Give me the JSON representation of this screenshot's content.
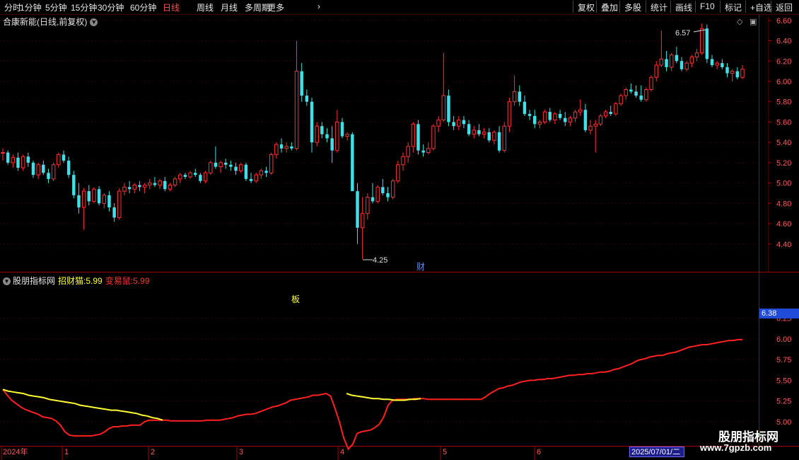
{
  "toolbar": {
    "periods": [
      "分时",
      "1分钟",
      "5分钟",
      "15分钟",
      "30分钟",
      "60分钟",
      "日线",
      "周线",
      "月线",
      "多周期",
      "更多"
    ],
    "active_period": "日线",
    "buttons": [
      "复权",
      "叠加",
      "多股",
      "统计",
      "画线",
      "F10",
      "标记",
      "+自选",
      "返回"
    ]
  },
  "main_title": "合康新能(日线,前复权)",
  "indicator": {
    "name": "股朋指标网",
    "series1_label": "招财猫:",
    "series1_value": "5.99",
    "series2_label": "变易鼠:",
    "series2_value": "5.99",
    "marker_text": "板",
    "current_price_tag": "6.38"
  },
  "annotations": {
    "high_label": "6.57",
    "low_label": "4.25",
    "cai_marker": "财"
  },
  "x_axis": {
    "year_label": "2024年",
    "month_labels": [
      "1",
      "2",
      "3",
      "4",
      "5",
      "6"
    ],
    "cursor_date": "2025/07/01/二"
  },
  "watermark": {
    "name": "股朋指标网",
    "url": "www.7gpzb.com"
  },
  "colors": {
    "up": "#ff3232",
    "down": "#3fe0e8",
    "yellow": "#ffff33",
    "red_line": "#ff2020",
    "grid": "#5a0000"
  },
  "chart_data": [
    {
      "type": "candlestick",
      "title": "合康新能(日线,前复权)",
      "ylim": [
        4.2,
        6.7
      ],
      "yticks": [
        4.4,
        4.6,
        4.8,
        5.0,
        5.2,
        5.4,
        5.6,
        5.8,
        6.0,
        6.2,
        6.4,
        6.6
      ],
      "ytick_labels": [
        "4.40",
        "4.60",
        "4.80",
        "5.00",
        "5.20",
        "5.40",
        "5.60",
        "5.80",
        "6.00",
        "6.20",
        "6.40",
        "6.60"
      ],
      "grid": true,
      "ohlc": [
        [
          5.3,
          5.34,
          5.22,
          5.3
        ],
        [
          5.3,
          5.32,
          5.18,
          5.2
        ],
        [
          5.2,
          5.28,
          5.15,
          5.25
        ],
        [
          5.25,
          5.3,
          5.12,
          5.15
        ],
        [
          5.15,
          5.28,
          5.12,
          5.26
        ],
        [
          5.26,
          5.3,
          5.16,
          5.2
        ],
        [
          5.2,
          5.22,
          5.05,
          5.08
        ],
        [
          5.08,
          5.2,
          5.04,
          5.18
        ],
        [
          5.18,
          5.22,
          5.08,
          5.1
        ],
        [
          5.1,
          5.14,
          5.0,
          5.04
        ],
        [
          5.04,
          5.2,
          5.02,
          5.18
        ],
        [
          5.18,
          5.3,
          5.15,
          5.28
        ],
        [
          5.28,
          5.32,
          5.2,
          5.22
        ],
        [
          5.22,
          5.26,
          5.05,
          5.08
        ],
        [
          5.08,
          5.12,
          4.85,
          4.88
        ],
        [
          4.88,
          5.0,
          4.7,
          4.76
        ],
        [
          4.76,
          4.95,
          4.54,
          4.92
        ],
        [
          4.92,
          4.98,
          4.78,
          4.82
        ],
        [
          4.82,
          4.96,
          4.8,
          4.94
        ],
        [
          4.94,
          4.97,
          4.78,
          4.8
        ],
        [
          4.8,
          4.9,
          4.75,
          4.88
        ],
        [
          4.88,
          4.92,
          4.72,
          4.76
        ],
        [
          4.76,
          4.8,
          4.62,
          4.66
        ],
        [
          4.66,
          4.95,
          4.64,
          4.92
        ],
        [
          4.92,
          5.0,
          4.88,
          4.96
        ],
        [
          4.96,
          5.02,
          4.9,
          4.94
        ],
        [
          4.94,
          5.0,
          4.9,
          4.98
        ],
        [
          4.98,
          5.02,
          4.92,
          4.96
        ],
        [
          4.96,
          5.0,
          4.9,
          4.98
        ],
        [
          4.98,
          5.04,
          4.94,
          5.0
        ],
        [
          5.0,
          5.06,
          4.96,
          4.98
        ],
        [
          4.98,
          5.04,
          4.94,
          5.02
        ],
        [
          5.02,
          5.06,
          4.92,
          4.94
        ],
        [
          4.94,
          5.0,
          4.92,
          4.98
        ],
        [
          4.98,
          5.06,
          4.96,
          5.04
        ],
        [
          5.04,
          5.1,
          5.0,
          5.08
        ],
        [
          5.08,
          5.1,
          5.04,
          5.06
        ],
        [
          5.06,
          5.12,
          5.04,
          5.1
        ],
        [
          5.1,
          5.14,
          5.06,
          5.08
        ],
        [
          5.08,
          5.1,
          5.0,
          5.02
        ],
        [
          5.02,
          5.12,
          5.0,
          5.1
        ],
        [
          5.1,
          5.22,
          5.08,
          5.2
        ],
        [
          5.2,
          5.36,
          5.14,
          5.16
        ],
        [
          5.16,
          5.22,
          5.1,
          5.2
        ],
        [
          5.2,
          5.24,
          5.14,
          5.18
        ],
        [
          5.18,
          5.22,
          5.12,
          5.16
        ],
        [
          5.16,
          5.2,
          5.08,
          5.12
        ],
        [
          5.12,
          5.2,
          5.1,
          5.18
        ],
        [
          5.18,
          5.2,
          5.02,
          5.04
        ],
        [
          5.04,
          5.1,
          5.0,
          5.02
        ],
        [
          5.02,
          5.1,
          5.0,
          5.08
        ],
        [
          5.08,
          5.14,
          5.04,
          5.12
        ],
        [
          5.12,
          5.16,
          5.06,
          5.1
        ],
        [
          5.1,
          5.3,
          5.08,
          5.28
        ],
        [
          5.28,
          5.4,
          5.24,
          5.38
        ],
        [
          5.38,
          5.44,
          5.3,
          5.34
        ],
        [
          5.34,
          5.4,
          5.3,
          5.36
        ],
        [
          5.36,
          5.4,
          5.32,
          5.34
        ],
        [
          5.34,
          6.4,
          5.32,
          6.1
        ],
        [
          6.1,
          6.18,
          5.8,
          5.86
        ],
        [
          5.86,
          5.92,
          5.76,
          5.8
        ],
        [
          5.8,
          5.84,
          5.3,
          5.4
        ],
        [
          5.4,
          5.6,
          5.36,
          5.56
        ],
        [
          5.56,
          5.6,
          5.44,
          5.48
        ],
        [
          5.48,
          5.54,
          5.4,
          5.44
        ],
        [
          5.44,
          5.56,
          5.2,
          5.32
        ],
        [
          5.32,
          5.72,
          5.3,
          5.6
        ],
        [
          5.6,
          5.64,
          5.44,
          5.46
        ],
        [
          5.46,
          5.5,
          5.42,
          5.48
        ],
        [
          5.48,
          5.5,
          5.1,
          4.92
        ],
        [
          4.92,
          5.0,
          4.4,
          4.56
        ],
        [
          4.56,
          4.86,
          4.25,
          4.7
        ],
        [
          4.7,
          4.9,
          4.64,
          4.86
        ],
        [
          4.86,
          5.0,
          4.8,
          4.82
        ],
        [
          4.82,
          4.98,
          4.8,
          4.96
        ],
        [
          4.96,
          5.04,
          4.88,
          4.9
        ],
        [
          4.9,
          4.96,
          4.82,
          4.86
        ],
        [
          4.86,
          5.04,
          4.84,
          5.02
        ],
        [
          5.02,
          5.22,
          5.0,
          5.18
        ],
        [
          5.18,
          5.3,
          5.12,
          5.26
        ],
        [
          5.26,
          5.4,
          5.2,
          5.36
        ],
        [
          5.36,
          5.6,
          5.3,
          5.58
        ],
        [
          5.58,
          5.62,
          5.28,
          5.32
        ],
        [
          5.32,
          5.38,
          5.26,
          5.3
        ],
        [
          5.3,
          5.4,
          5.28,
          5.34
        ],
        [
          5.34,
          5.58,
          5.32,
          5.56
        ],
        [
          5.56,
          5.66,
          5.5,
          5.62
        ],
        [
          5.62,
          6.28,
          5.6,
          5.86
        ],
        [
          5.86,
          5.92,
          5.56,
          5.6
        ],
        [
          5.6,
          5.66,
          5.52,
          5.56
        ],
        [
          5.56,
          5.66,
          5.52,
          5.62
        ],
        [
          5.62,
          5.66,
          5.54,
          5.58
        ],
        [
          5.58,
          5.62,
          5.46,
          5.48
        ],
        [
          5.48,
          5.56,
          5.44,
          5.52
        ],
        [
          5.52,
          5.58,
          5.46,
          5.48
        ],
        [
          5.48,
          5.54,
          5.44,
          5.5
        ],
        [
          5.5,
          5.54,
          5.4,
          5.42
        ],
        [
          5.42,
          5.52,
          5.38,
          5.5
        ],
        [
          5.5,
          5.56,
          5.3,
          5.32
        ],
        [
          5.32,
          5.6,
          5.3,
          5.56
        ],
        [
          5.56,
          5.84,
          5.5,
          5.8
        ],
        [
          5.8,
          6.06,
          5.76,
          5.9
        ],
        [
          5.9,
          5.96,
          5.76,
          5.8
        ],
        [
          5.8,
          5.86,
          5.66,
          5.68
        ],
        [
          5.68,
          5.72,
          5.62,
          5.66
        ],
        [
          5.66,
          5.72,
          5.54,
          5.58
        ],
        [
          5.58,
          5.62,
          5.54,
          5.6
        ],
        [
          5.6,
          5.72,
          5.58,
          5.7
        ],
        [
          5.7,
          5.74,
          5.6,
          5.62
        ],
        [
          5.62,
          5.7,
          5.58,
          5.68
        ],
        [
          5.68,
          5.72,
          5.62,
          5.64
        ],
        [
          5.64,
          5.7,
          5.56,
          5.6
        ],
        [
          5.6,
          5.66,
          5.56,
          5.64
        ],
        [
          5.64,
          5.72,
          5.6,
          5.7
        ],
        [
          5.7,
          5.82,
          5.66,
          5.72
        ],
        [
          5.72,
          5.78,
          5.5,
          5.52
        ],
        [
          5.52,
          5.62,
          5.48,
          5.56
        ],
        [
          5.56,
          5.62,
          5.3,
          5.58
        ],
        [
          5.58,
          5.68,
          5.56,
          5.66
        ],
        [
          5.66,
          5.72,
          5.64,
          5.7
        ],
        [
          5.7,
          5.76,
          5.66,
          5.68
        ],
        [
          5.68,
          5.8,
          5.66,
          5.78
        ],
        [
          5.78,
          5.88,
          5.76,
          5.86
        ],
        [
          5.86,
          5.94,
          5.82,
          5.92
        ],
        [
          5.92,
          5.98,
          5.88,
          5.9
        ],
        [
          5.9,
          5.96,
          5.84,
          5.86
        ],
        [
          5.86,
          5.96,
          5.8,
          5.82
        ],
        [
          5.82,
          5.94,
          5.8,
          5.92
        ],
        [
          5.92,
          6.06,
          5.9,
          6.04
        ],
        [
          6.04,
          6.2,
          6.0,
          6.16
        ],
        [
          6.16,
          6.5,
          6.14,
          6.22
        ],
        [
          6.22,
          6.3,
          6.1,
          6.14
        ],
        [
          6.14,
          6.28,
          6.1,
          6.26
        ],
        [
          6.26,
          6.34,
          6.18,
          6.2
        ],
        [
          6.2,
          6.24,
          6.1,
          6.12
        ],
        [
          6.12,
          6.2,
          6.1,
          6.18
        ],
        [
          6.18,
          6.26,
          6.14,
          6.24
        ],
        [
          6.24,
          6.32,
          6.2,
          6.28
        ],
        [
          6.28,
          6.57,
          6.26,
          6.52
        ],
        [
          6.52,
          6.56,
          6.18,
          6.22
        ],
        [
          6.22,
          6.26,
          6.14,
          6.16
        ],
        [
          6.16,
          6.2,
          6.12,
          6.18
        ],
        [
          6.18,
          6.22,
          6.12,
          6.14
        ],
        [
          6.14,
          6.18,
          6.04,
          6.08
        ],
        [
          6.08,
          6.12,
          6.0,
          6.1
        ],
        [
          6.1,
          6.14,
          6.02,
          6.04
        ],
        [
          6.04,
          6.16,
          6.02,
          6.12
        ]
      ]
    },
    {
      "type": "line",
      "ylim": [
        5.0,
        6.45
      ],
      "yticks": [
        5.0,
        5.25,
        5.5,
        5.75,
        6.0,
        6.25
      ],
      "ytick_labels": [
        "5.00",
        "5.25",
        "5.50",
        "5.75",
        "6.00",
        "6.25"
      ],
      "grid": true,
      "series": [
        {
          "name": "招财猫",
          "color": "#ffff33",
          "values": [
            5.39,
            5.37,
            5.36,
            5.35,
            5.34,
            5.32,
            5.31,
            5.3,
            5.29,
            5.27,
            5.26,
            5.25,
            5.24,
            5.23,
            5.22,
            5.2,
            5.19,
            5.18,
            5.17,
            5.16,
            5.15,
            5.14,
            5.14,
            5.13,
            5.12,
            5.11,
            5.1,
            5.08,
            5.07,
            5.05,
            5.04,
            5.02
          ]
        },
        {
          "name": "变易鼠",
          "color": "#ff2020",
          "values": [
            5.39,
            5.32,
            5.26,
            5.22,
            5.18,
            5.15,
            5.13,
            5.11,
            5.09,
            5.06,
            5.05,
            5.04,
            5.01,
            4.96,
            4.88,
            4.84,
            4.83,
            4.83,
            4.83,
            4.83,
            4.83,
            4.84,
            4.85,
            4.88,
            4.92,
            4.94,
            4.94,
            4.95,
            4.95,
            4.96,
            4.96,
            4.96,
            5.0,
            5.02,
            5.02,
            5.02,
            5.02,
            5.02,
            5.01,
            5.01,
            5.01,
            5.01,
            5.01,
            5.01,
            5.01,
            5.01,
            5.02,
            5.02,
            5.02,
            5.02,
            5.03,
            5.04,
            5.05,
            5.07,
            5.08,
            5.09,
            5.09,
            5.1,
            5.12,
            5.14,
            5.16,
            5.18,
            5.19,
            5.21,
            5.23,
            5.26,
            5.27,
            5.28,
            5.29,
            5.3,
            5.32,
            5.32,
            5.33,
            5.34,
            5.31,
            5.16,
            5.0,
            4.8,
            4.67,
            4.73,
            4.86,
            4.88,
            4.89,
            4.9,
            4.93,
            4.97,
            5.06,
            5.2,
            5.26,
            5.27,
            5.27,
            5.27,
            5.27,
            5.28,
            5.28,
            5.28,
            5.27,
            5.27,
            5.27,
            5.27,
            5.27,
            5.27,
            5.27,
            5.27,
            5.27,
            5.27,
            5.27,
            5.27,
            5.27,
            5.3,
            5.34,
            5.37,
            5.4,
            5.41,
            5.43,
            5.44,
            5.46,
            5.48,
            5.49,
            5.5,
            5.5,
            5.51,
            5.51,
            5.52,
            5.52,
            5.53,
            5.54,
            5.55,
            5.56,
            5.56,
            5.57,
            5.57,
            5.58,
            5.58,
            5.59,
            5.6,
            5.6,
            5.61,
            5.63,
            5.64,
            5.66,
            5.68,
            5.7,
            5.73,
            5.75,
            5.76,
            5.78,
            5.79,
            5.8,
            5.8,
            5.82,
            5.83,
            5.84,
            5.86,
            5.88,
            5.9,
            5.91,
            5.92,
            5.93,
            5.93,
            5.94,
            5.95,
            5.96,
            5.97,
            5.98,
            5.98,
            5.99,
            5.99
          ]
        }
      ]
    }
  ]
}
